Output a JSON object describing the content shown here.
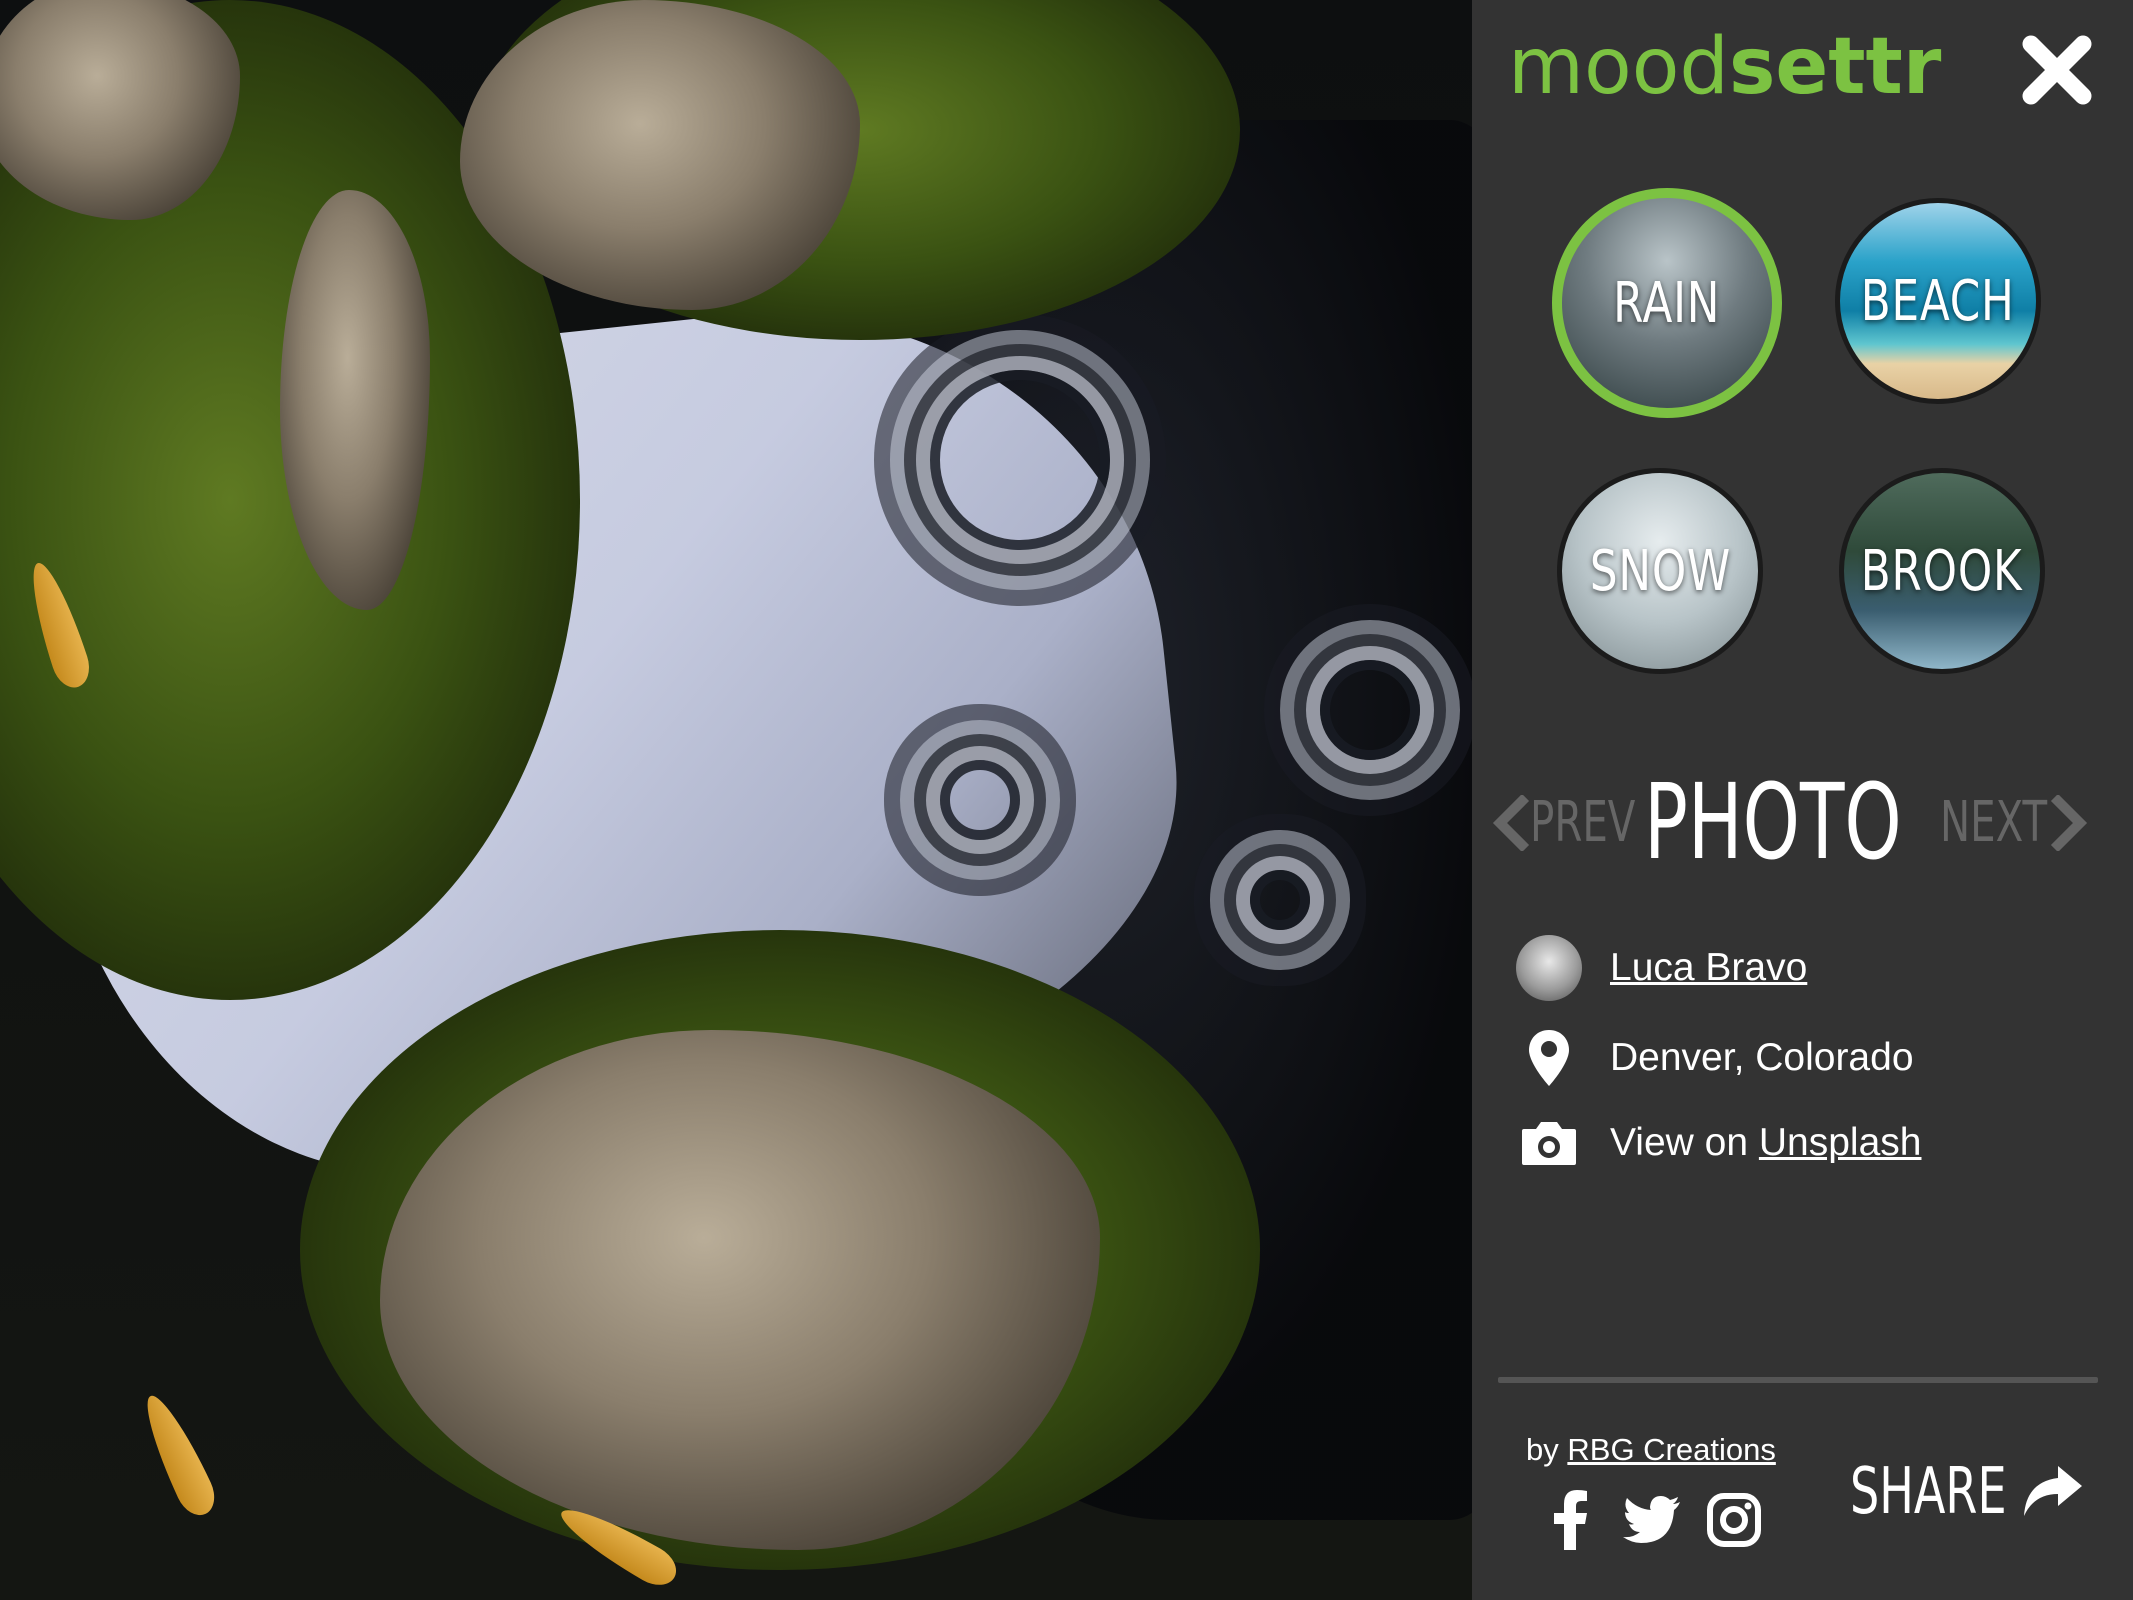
{
  "app": {
    "logo_part1": "mood",
    "logo_part2": "settr",
    "accent_color": "#7cc242",
    "close_icon": "close-icon"
  },
  "moods": [
    {
      "label": "RAIN",
      "active": true
    },
    {
      "label": "BEACH",
      "active": false
    },
    {
      "label": "SNOW",
      "active": false
    },
    {
      "label": "BROOK",
      "active": false
    }
  ],
  "photo_nav": {
    "prev_label": "PREV",
    "title": "PHOTO",
    "next_label": "NEXT"
  },
  "photo_credit": {
    "author": "Luca Bravo",
    "location": "Denver, Colorado",
    "view_on_prefix": "View on",
    "view_on_link": "Unsplash"
  },
  "footer": {
    "by_prefix": "by",
    "creator": "RBG Creations",
    "social_icons": [
      "facebook-icon",
      "twitter-icon",
      "instagram-icon"
    ],
    "share_label": "SHARE"
  }
}
